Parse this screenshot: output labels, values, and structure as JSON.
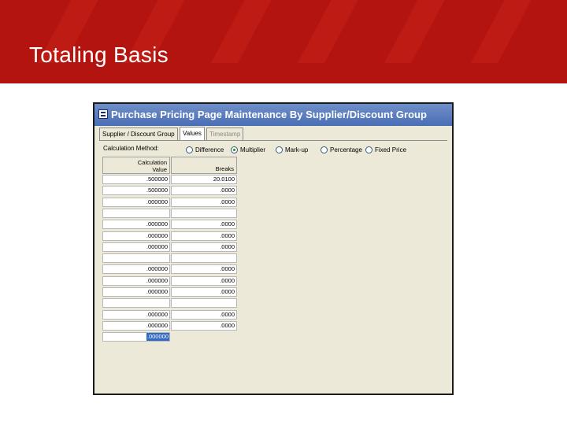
{
  "slide": {
    "title": "Totaling Basis"
  },
  "window": {
    "title": "Purchase Pricing Page Maintenance By Supplier/Discount Group",
    "tabs": [
      {
        "label": "Supplier / Discount Group",
        "state": "normal"
      },
      {
        "label": "Values",
        "state": "active"
      },
      {
        "label": "Timestamp",
        "state": "disabled"
      }
    ],
    "calculation_method": {
      "label": "Calculation Method:",
      "options": [
        "Difference",
        "Multiplier",
        "Mark-up",
        "Percentage",
        "Fixed Price"
      ],
      "selected": "Multiplier"
    },
    "grid": {
      "headers": [
        "Calculation\nValue",
        "Breaks"
      ],
      "rows": [
        [
          ".500000",
          "20.0100"
        ],
        [
          ".500000",
          ".0000"
        ],
        [
          ".000000",
          ".0000"
        ],
        [
          "",
          ""
        ],
        [
          ".000000",
          ".0000"
        ],
        [
          ".000000",
          ".0000"
        ],
        [
          ".000000",
          ".0000"
        ],
        [
          "",
          ""
        ],
        [
          ".000000",
          ".0000"
        ],
        [
          ".000000",
          ".0000"
        ],
        [
          ".000000",
          ".0000"
        ],
        [
          "",
          ""
        ],
        [
          ".000000",
          ".0000"
        ],
        [
          ".000000",
          ".0000"
        ],
        [
          ".000000",
          ""
        ]
      ]
    }
  },
  "colors": {
    "header_red": "#b4140f",
    "titlebar_blue": "#4a6eb5",
    "window_bg": "#ece9d8",
    "selection_blue": "#316ac5"
  }
}
